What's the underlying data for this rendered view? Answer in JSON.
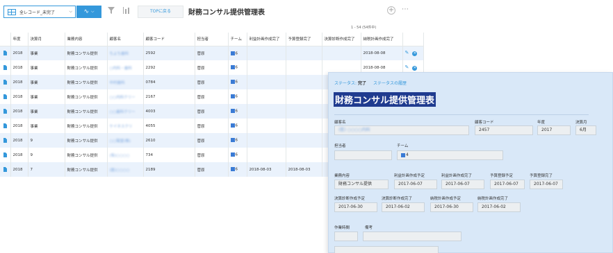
{
  "toolbar": {
    "view_name": "全レコード_未完了",
    "top_button": "TOPに戻る",
    "title": "財務コンサル提供管理表",
    "pager": "1 - 54  (54件中)"
  },
  "table": {
    "headers": [
      "年度",
      "決算月",
      "業務内容",
      "顧客名",
      "顧客コード",
      "担当者",
      "チーム",
      "利益計画作成完了",
      "予算登録完了",
      "決算診断作成完了",
      "納税計画作成完了"
    ],
    "rows": [
      {
        "year": "2018",
        "month": "事業",
        "work": "財務コンサル提供",
        "customer": "ちよち歯科",
        "code": "2592",
        "staff": "菅原",
        "team": "6",
        "c1": "",
        "c2": "",
        "c3": "",
        "c4": "2018-08-08"
      },
      {
        "year": "2018",
        "month": "事業",
        "work": "財務コンサル提供",
        "customer": "○内科・歯科",
        "code": "2292",
        "staff": "菅原",
        "team": "6",
        "c1": "",
        "c2": "",
        "c3": "",
        "c4": "2018-08-08"
      },
      {
        "year": "2018",
        "month": "事業",
        "work": "財務コンサル提供",
        "customer": "中村歯科",
        "code": "0784",
        "staff": "菅原",
        "team": "6",
        "c1": "",
        "c2": "",
        "c3": "",
        "c4": ""
      },
      {
        "year": "2018",
        "month": "事業",
        "work": "財務コンサル提供",
        "customer": "○○内科クリー",
        "code": "2167",
        "staff": "菅原",
        "team": "6",
        "c1": "",
        "c2": "",
        "c3": "",
        "c4": ""
      },
      {
        "year": "2018",
        "month": "事業",
        "work": "財務コンサル提供",
        "customer": "○○歯科クリー",
        "code": "4003",
        "staff": "菅原",
        "team": "6",
        "c1": "",
        "c2": "",
        "c3": "",
        "c4": ""
      },
      {
        "year": "2018",
        "month": "事業",
        "work": "財務コンサル提供",
        "customer": "ケイネスクリ",
        "code": "4055",
        "staff": "菅原",
        "team": "6",
        "c1": "",
        "c2": "",
        "c3": "",
        "c4": ""
      },
      {
        "year": "2018",
        "month": "9",
        "work": "財務コンサル提供",
        "customer": "○○陽堂(株)",
        "code": "2610",
        "staff": "菅原",
        "team": "6",
        "c1": "",
        "c2": "",
        "c3": "",
        "c4": ""
      },
      {
        "year": "2018",
        "month": "9",
        "work": "財務コンサル提供",
        "customer": "(有)○○○○",
        "code": "734",
        "staff": "菅原",
        "team": "6",
        "c1": "",
        "c2": "",
        "c3": "",
        "c4": ""
      },
      {
        "year": "2018",
        "month": "7",
        "work": "財務コンサル提供",
        "customer": "(医)○○○○",
        "code": "2189",
        "staff": "菅原",
        "team": "6",
        "c1": "2018-08-03",
        "c2": "2018-08-03",
        "c3": "",
        "c4": ""
      }
    ]
  },
  "detail": {
    "status_label": "ステータス:",
    "status_value": "完了",
    "history_link": "ステータスの履歴",
    "title": "財務コンサル提供管理表",
    "customer_label": "顧客名",
    "customer_value": "(医) ○○○○内科",
    "code_label": "顧客コード",
    "code_value": "2457",
    "year_label": "年度",
    "year_value": "2017",
    "month_label": "決算月",
    "month_value": "6月",
    "staff_label": "担当者",
    "staff_value": "",
    "team_label": "チーム",
    "team_value": "4",
    "work_label": "業務内容",
    "work_value": "財務コンサル提供",
    "profit_plan_label": "利益計画作成予定",
    "profit_plan_value": "2017-06-07",
    "profit_done_label": "利益計画作成完了",
    "profit_done_value": "2017-06-07",
    "budget_plan_label": "予算登録予定",
    "budget_plan_value": "2017-06-07",
    "budget_done_label": "予算登録完了",
    "budget_done_value": "2017-06-07",
    "settle_plan_label": "決算診断作成予定",
    "settle_plan_value": "2017-06-30",
    "settle_done_label": "決算診断作成完了",
    "settle_done_value": "2017-06-02",
    "tax_plan_label": "納税計画作成予定",
    "tax_plan_value": "2017-06-30",
    "tax_done_label": "納税計画作成完了",
    "tax_done_value": "2017-06-02",
    "worktime_label": "作業時間",
    "note_label": "備考"
  }
}
